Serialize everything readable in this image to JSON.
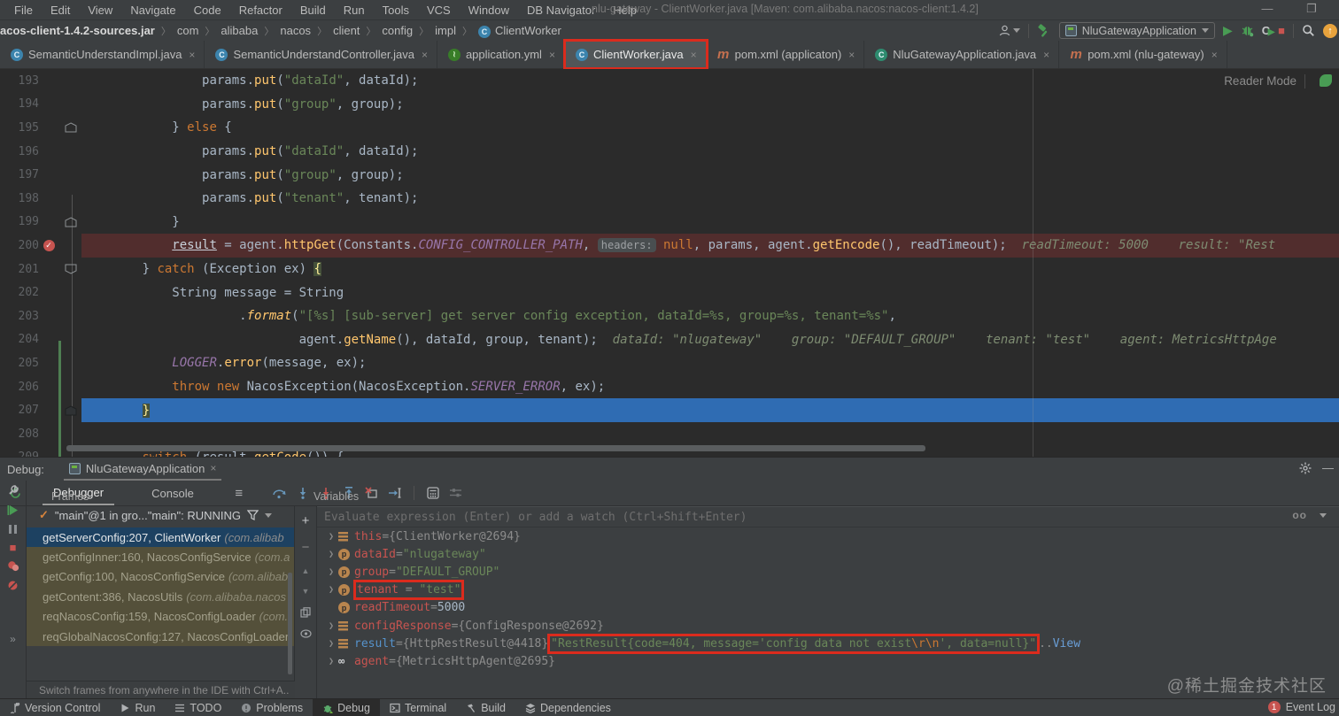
{
  "window": {
    "title": "nlu-gateway - ClientWorker.java [Maven: com.alibaba.nacos:nacos-client:1.4.2]",
    "minimize": "—",
    "restore": "❐"
  },
  "menu": [
    "File",
    "Edit",
    "View",
    "Navigate",
    "Code",
    "Refactor",
    "Build",
    "Run",
    "Tools",
    "VCS",
    "Window",
    "DB Navigator",
    "Help"
  ],
  "breadcrumbs": [
    "acos-client-1.4.2-sources.jar",
    "com",
    "alibaba",
    "nacos",
    "client",
    "config",
    "impl",
    "ClientWorker"
  ],
  "toolbar": {
    "run_config": "NluGatewayApplication"
  },
  "tabs": [
    {
      "label": "SemanticUnderstandImpl.java",
      "icon": "class",
      "close": "×"
    },
    {
      "label": "SemanticUnderstandController.java",
      "icon": "class",
      "close": "×"
    },
    {
      "label": "application.yml",
      "icon": "spring",
      "close": "×"
    },
    {
      "label": "ClientWorker.java",
      "icon": "class",
      "close": "×",
      "active": true,
      "annotated": true
    },
    {
      "label": "pom.xml (applicaton)",
      "icon": "maven",
      "close": "×"
    },
    {
      "label": "NluGatewayApplication.java",
      "icon": "boot",
      "close": "×"
    },
    {
      "label": "pom.xml (nlu-gateway)",
      "icon": "maven",
      "close": "×"
    }
  ],
  "editor": {
    "reader_mode": "Reader Mode",
    "lines": [
      {
        "num": 193,
        "ind": 14,
        "seg": [
          [
            "p",
            "params."
          ],
          [
            "m",
            "put"
          ],
          [
            "p",
            "("
          ],
          [
            "s",
            "\"dataId\""
          ],
          [
            "p",
            ", dataId);"
          ]
        ]
      },
      {
        "num": 194,
        "ind": 14,
        "seg": [
          [
            "p",
            "params."
          ],
          [
            "m",
            "put"
          ],
          [
            "p",
            "("
          ],
          [
            "s",
            "\"group\""
          ],
          [
            "p",
            ", group);"
          ]
        ]
      },
      {
        "num": 195,
        "ind": 10,
        "gut": "fold-up",
        "seg": [
          [
            "p",
            "} "
          ],
          [
            "k",
            "else"
          ],
          [
            "p",
            " {"
          ]
        ]
      },
      {
        "num": 196,
        "ind": 14,
        "seg": [
          [
            "p",
            "params."
          ],
          [
            "m",
            "put"
          ],
          [
            "p",
            "("
          ],
          [
            "s",
            "\"dataId\""
          ],
          [
            "p",
            ", dataId);"
          ]
        ]
      },
      {
        "num": 197,
        "ind": 14,
        "seg": [
          [
            "p",
            "params."
          ],
          [
            "m",
            "put"
          ],
          [
            "p",
            "("
          ],
          [
            "s",
            "\"group\""
          ],
          [
            "p",
            ", group);"
          ]
        ]
      },
      {
        "num": 198,
        "ind": 14,
        "seg": [
          [
            "p",
            "params."
          ],
          [
            "m",
            "put"
          ],
          [
            "p",
            "("
          ],
          [
            "s",
            "\"tenant\""
          ],
          [
            "p",
            ", tenant);"
          ]
        ]
      },
      {
        "num": 199,
        "ind": 10,
        "gut": "fold-up",
        "seg": [
          [
            "p",
            "}"
          ]
        ]
      },
      {
        "num": 200,
        "ind": 10,
        "gut": "bp",
        "bg": "red",
        "seg": [
          [
            "u",
            "result"
          ],
          [
            "p",
            " = agent."
          ],
          [
            "m",
            "httpGet"
          ],
          [
            "p",
            "(Constants."
          ],
          [
            "f",
            "CONFIG_CONTROLLER_PATH"
          ],
          [
            "p",
            ", "
          ],
          [
            "chip",
            "headers:"
          ],
          [
            "p",
            " "
          ],
          [
            "k",
            "null"
          ],
          [
            "p",
            ", params, agent."
          ],
          [
            "m",
            "getEncode"
          ],
          [
            "p",
            "(), readTimeout);"
          ],
          [
            "h",
            "  readTimeout: 5000    result: \"Rest"
          ]
        ]
      },
      {
        "num": 201,
        "ind": 6,
        "gut": "fold-down",
        "seg": [
          [
            "p",
            "} "
          ],
          [
            "k",
            "catch"
          ],
          [
            "p",
            " (Exception ex) "
          ],
          [
            "br",
            "{"
          ]
        ]
      },
      {
        "num": 202,
        "ind": 10,
        "seg": [
          [
            "p",
            "String message = String"
          ]
        ]
      },
      {
        "num": 203,
        "ind": 19,
        "seg": [
          [
            "p",
            "."
          ],
          [
            "mi",
            "format"
          ],
          [
            "p",
            "("
          ],
          [
            "s",
            "\"[%s] [sub-server] get server config exception, dataId=%s, group=%s, tenant=%s\""
          ],
          [
            "p",
            ","
          ]
        ]
      },
      {
        "num": 204,
        "ind": 27,
        "seg": [
          [
            "p",
            "agent."
          ],
          [
            "m",
            "getName"
          ],
          [
            "p",
            "(), dataId, group, tenant);"
          ],
          [
            "h",
            "  dataId: \"nlugateway\"    group: \"DEFAULT_GROUP\"    tenant: \"test\"    agent: MetricsHttpAge"
          ]
        ]
      },
      {
        "num": 205,
        "ind": 10,
        "seg": [
          [
            "f",
            "LOGGER"
          ],
          [
            "p",
            "."
          ],
          [
            "m",
            "error"
          ],
          [
            "p",
            "(message, ex);"
          ]
        ]
      },
      {
        "num": 206,
        "ind": 10,
        "seg": [
          [
            "k",
            "throw"
          ],
          [
            "p",
            " "
          ],
          [
            "k",
            "new"
          ],
          [
            "p",
            " NacosException(NacosException."
          ],
          [
            "f",
            "SERVER_ERROR"
          ],
          [
            "p",
            ", ex);"
          ]
        ]
      },
      {
        "num": 207,
        "ind": 6,
        "gut": "fold-filled",
        "bg": "blue",
        "seg": [
          [
            "br",
            "}"
          ]
        ]
      },
      {
        "num": 208,
        "ind": 0,
        "seg": []
      },
      {
        "num": 209,
        "ind": 6,
        "seg": [
          [
            "k",
            "switch"
          ],
          [
            "p",
            " (result."
          ],
          [
            "m",
            "getCode"
          ],
          [
            "p",
            "()) {"
          ]
        ]
      }
    ]
  },
  "debug": {
    "label": "Debug:",
    "session_tab": "NluGatewayApplication",
    "session_close": "×",
    "tabs": {
      "debugger": "Debugger",
      "console": "Console"
    },
    "frames": {
      "header": "Frames",
      "thread": "\"main\"@1 in gro...\"main\": RUNNING",
      "rows": [
        {
          "text": "getServerConfig:207, ClientWorker",
          "pkg": "(com.alibab",
          "cls": "selected"
        },
        {
          "text": "getConfigInner:160, NacosConfigService",
          "pkg": "(com.a",
          "cls": "lib"
        },
        {
          "text": "getConfig:100, NacosConfigService",
          "pkg": "(com.alibab",
          "cls": "lib"
        },
        {
          "text": "getContent:386, NacosUtils",
          "pkg": "(com.alibaba.nacos",
          "cls": "lib"
        },
        {
          "text": "reqNacosConfig:159, NacosConfigLoader",
          "pkg": "(com.",
          "cls": "lib"
        },
        {
          "text": "reqGlobalNacosConfig:127, NacosConfigLoader",
          "pkg": "",
          "cls": "lib"
        }
      ],
      "hint": "Switch frames from anywhere in the IDE with Ctrl+A..",
      "hint_close": "×"
    },
    "variables": {
      "header": "Variables",
      "evaluate_placeholder": "Evaluate expression (Enter) or add a watch (Ctrl+Shift+Enter)",
      "rows": [
        {
          "exp": true,
          "icon": "obj",
          "name": "this",
          "ncls": "vn",
          "parts": [
            [
              "eq",
              " = "
            ],
            [
              "ref",
              "{ClientWorker@2694}"
            ]
          ]
        },
        {
          "exp": true,
          "icon": "param",
          "name": "dataId",
          "ncls": "vn",
          "parts": [
            [
              "eq",
              " = "
            ],
            [
              "str",
              "\"nlugateway\""
            ]
          ]
        },
        {
          "exp": true,
          "icon": "param",
          "name": "group",
          "ncls": "vn",
          "parts": [
            [
              "eq",
              " = "
            ],
            [
              "str",
              "\"DEFAULT_GROUP\""
            ]
          ]
        },
        {
          "exp": true,
          "icon": "param",
          "name": "tenant",
          "ncls": "vn",
          "annotated": true,
          "parts": [
            [
              "eq",
              " = "
            ],
            [
              "str",
              "\"test\""
            ]
          ]
        },
        {
          "exp": false,
          "icon": "param",
          "name": "readTimeout",
          "ncls": "vn",
          "parts": [
            [
              "eq",
              " = "
            ],
            [
              "val",
              "5000"
            ]
          ]
        },
        {
          "exp": true,
          "icon": "obj",
          "name": "configResponse",
          "ncls": "vn",
          "parts": [
            [
              "eq",
              " = "
            ],
            [
              "ref",
              "{ConfigResponse@2692}"
            ]
          ]
        },
        {
          "exp": true,
          "icon": "obj",
          "name": "result",
          "ncls": "vn-blue",
          "parts": [
            [
              "eq",
              " = "
            ],
            [
              "ref",
              "{HttpRestResult@4418} "
            ],
            [
              "box",
              [
                [
                  "str",
                  "\"RestResult{code=404, message='config data not exist"
                ],
                [
                  "esc",
                  "\\r\\n"
                ],
                [
                  "str",
                  "', data=null}\""
                ]
              ]
            ],
            [
              "ref",
              " .. "
            ],
            [
              "link",
              "View"
            ]
          ]
        },
        {
          "exp": true,
          "icon": "watch",
          "name": "agent",
          "ncls": "vn",
          "parts": [
            [
              "eq",
              " = "
            ],
            [
              "ref",
              "{MetricsHttpAgent@2695}"
            ]
          ]
        }
      ]
    }
  },
  "status_bar": {
    "items": [
      {
        "icon": "branch",
        "label": "Version Control"
      },
      {
        "icon": "play",
        "label": "Run"
      },
      {
        "icon": "list",
        "label": "TODO"
      },
      {
        "icon": "error",
        "label": "Problems"
      },
      {
        "icon": "bug",
        "label": "Debug",
        "active": true
      },
      {
        "icon": "terminal",
        "label": "Terminal"
      },
      {
        "icon": "hammer",
        "label": "Build"
      },
      {
        "icon": "layers",
        "label": "Dependencies"
      }
    ],
    "event_log": {
      "badge": "1",
      "label": "Event Log"
    }
  },
  "watermark": "@稀土掘金技术社区",
  "colors": {
    "annotation_red": "#DB2B1D",
    "breakpoint_line_bg": "#512D2D",
    "execution_line_bg": "#2F6CB3",
    "breakpoint_red": "#C75450",
    "string_green": "#6A8759",
    "keyword_orange": "#CC7832",
    "method_yellow": "#FFC66D",
    "run_green": "#499C54"
  }
}
